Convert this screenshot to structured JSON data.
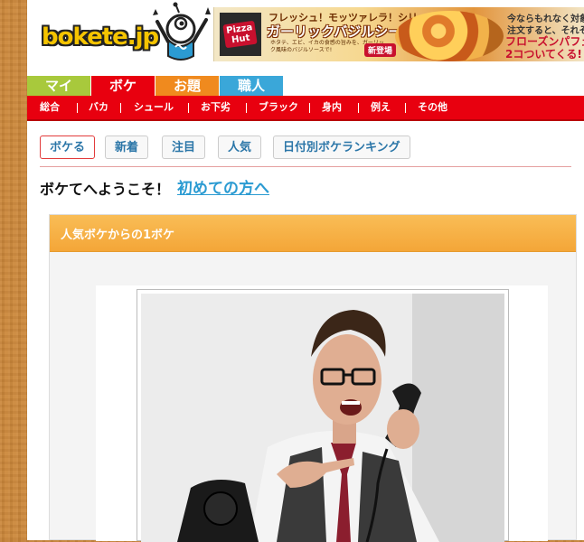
{
  "header": {
    "logo_text": "bokete.jp",
    "ad": {
      "brand_line1": "Pizza",
      "brand_line2": "Hut",
      "headline1": "フレッシュ！モッツァレラ！シリーズ",
      "headline2": "ガーリックバジルシーフード",
      "description": "ホタテ、エビ、イカの食感の旨みを、ガーリック風味のバジルソースで!",
      "badge": "新登場",
      "right_line1": "今ならもれなく対象",
      "right_line2": "注文すると、それぞれ",
      "right_line3": "フローズンパフェ",
      "right_line4": "2コついてくる!"
    }
  },
  "nav": {
    "tabs": [
      {
        "label": "マイ",
        "color": "#a8c93c"
      },
      {
        "label": "ボケ",
        "color": "#e8000f"
      },
      {
        "label": "お題",
        "color": "#f08a1e"
      },
      {
        "label": "職人",
        "color": "#3aa7d9"
      }
    ],
    "active_tab": "ボケ",
    "subnav": [
      "総合",
      "バカ",
      "シュール",
      "お下劣",
      "ブラック",
      "身内",
      "例え",
      "その他"
    ]
  },
  "filters": [
    "ボケる",
    "新着",
    "注目",
    "人気",
    "日付別ボケランキング"
  ],
  "welcome": {
    "text": "ボケてへようこそ！",
    "link": "初めての方へ"
  },
  "panel": {
    "title": "人気ボケからの1ボケ"
  },
  "colors": {
    "accent_red": "#e8000f",
    "panel_orange": "#f4a638",
    "link_blue": "#2b9bd2"
  }
}
